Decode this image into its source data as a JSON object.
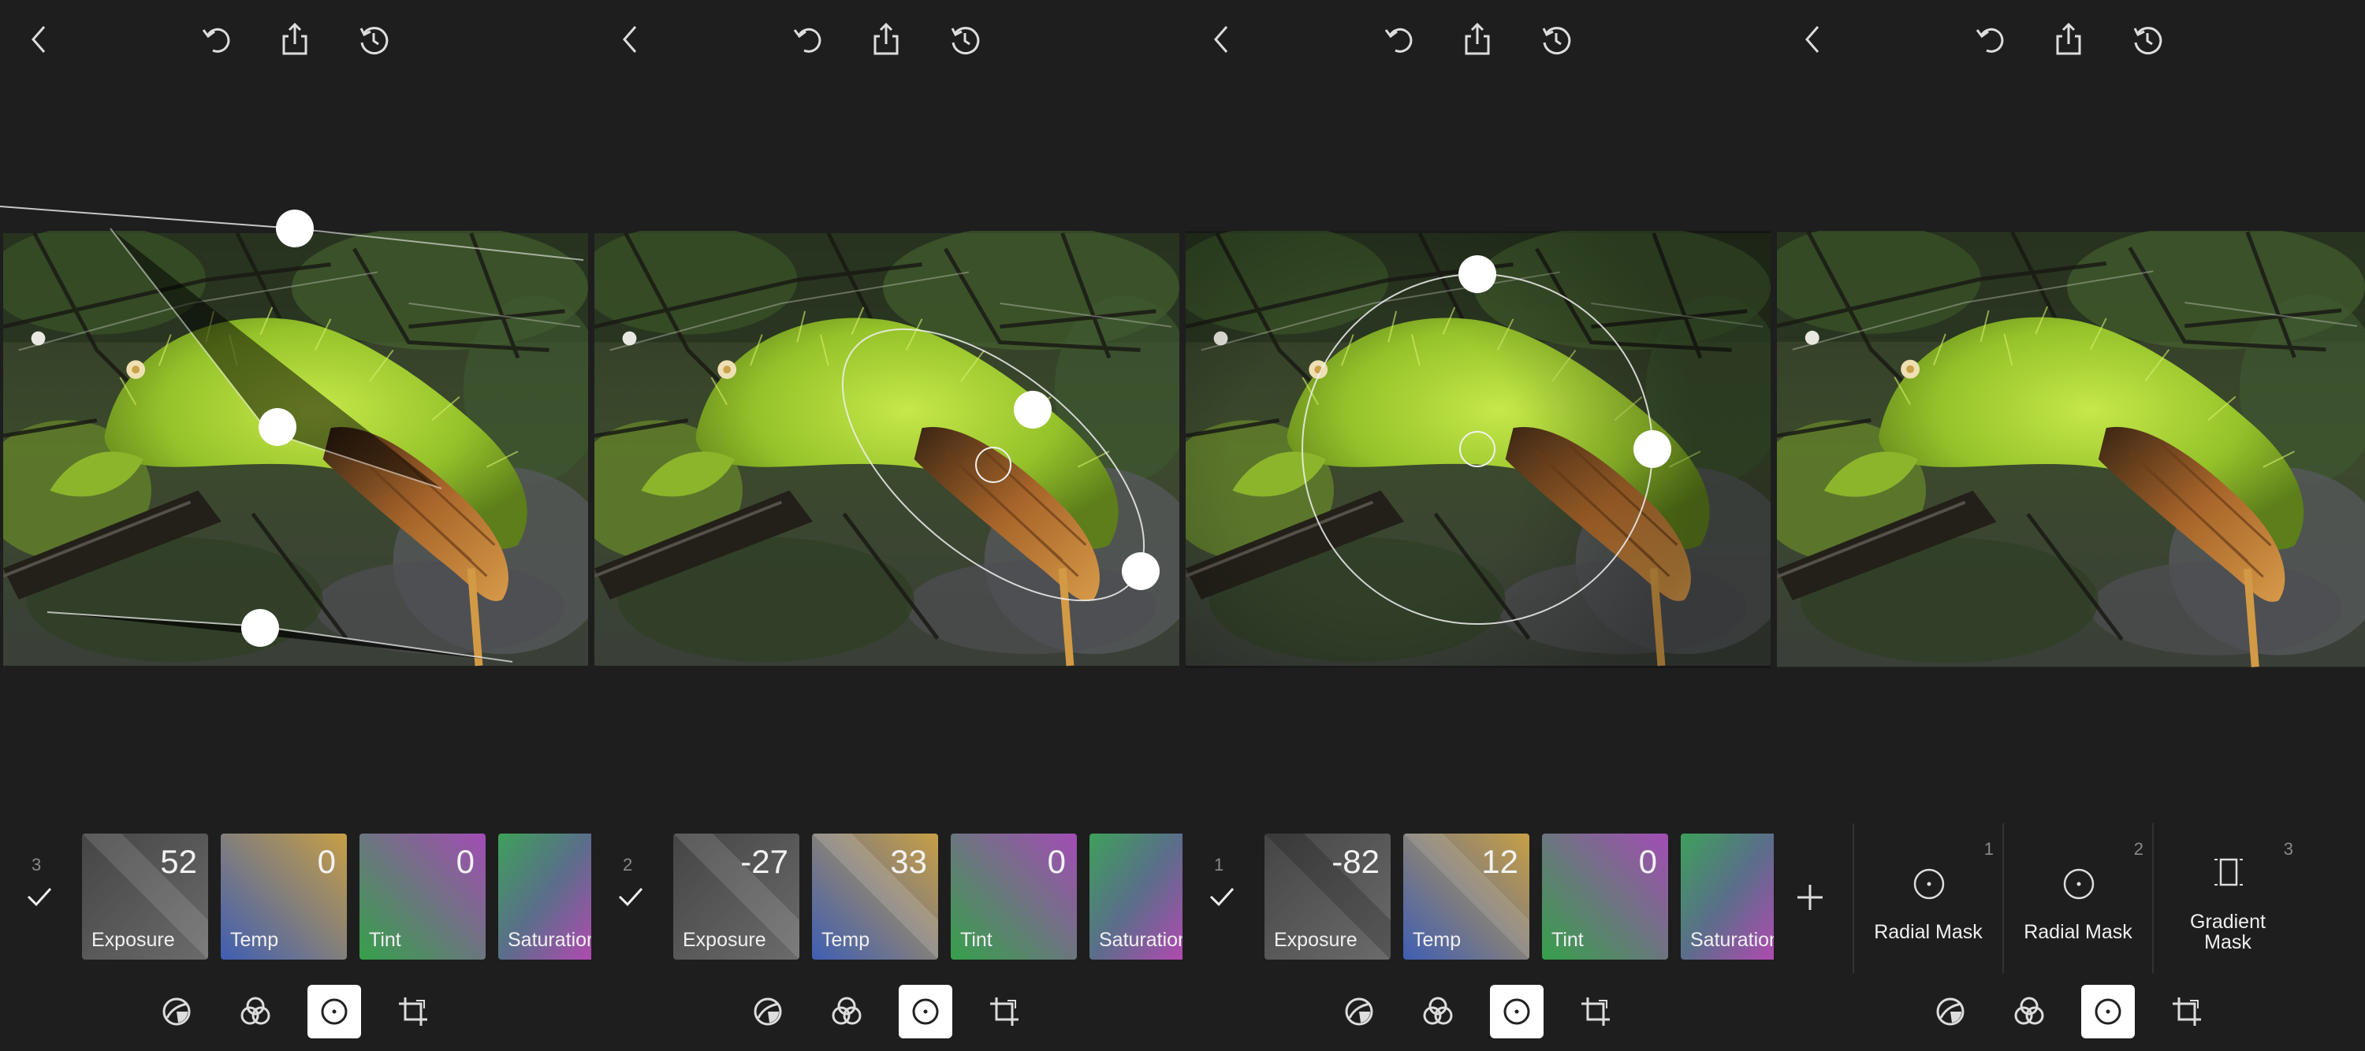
{
  "screens": [
    {
      "layer_count": "3",
      "tiles": [
        {
          "value": "52",
          "label": "Exposure"
        },
        {
          "value": "0",
          "label": "Temp"
        },
        {
          "value": "0",
          "label": "Tint"
        },
        {
          "value": "",
          "label": "Saturation"
        }
      ]
    },
    {
      "layer_count": "2",
      "tiles": [
        {
          "value": "-27",
          "label": "Exposure"
        },
        {
          "value": "33",
          "label": "Temp"
        },
        {
          "value": "0",
          "label": "Tint"
        },
        {
          "value": "",
          "label": "Saturation"
        }
      ]
    },
    {
      "layer_count": "1",
      "tiles": [
        {
          "value": "-82",
          "label": "Exposure"
        },
        {
          "value": "12",
          "label": "Temp"
        },
        {
          "value": "0",
          "label": "Tint"
        },
        {
          "value": "",
          "label": "Saturation"
        }
      ]
    }
  ],
  "mask_panel": {
    "masks": [
      {
        "number": "1",
        "label": "Radial Mask",
        "icon": "radial-mask-icon"
      },
      {
        "number": "2",
        "label": "Radial Mask",
        "icon": "radial-mask-icon"
      },
      {
        "number": "3",
        "label": "Gradient Mask",
        "icon": "gradient-mask-icon"
      }
    ]
  },
  "toolbar_icons": [
    "back-icon",
    "undo-icon",
    "share-icon",
    "revert-icon"
  ],
  "bottom_tools": [
    "tone-curve-icon",
    "color-mix-icon",
    "mask-tool-icon",
    "crop-icon"
  ],
  "colors": {
    "background": "#1e1e1e",
    "active_tool_bg": "#ffffff",
    "exposure_tile": "#5a5a5a",
    "temp_tile_a": "#c9a24a",
    "temp_tile_b": "#4a63b0",
    "tint_tile_a": "#9a4fb0",
    "tint_tile_b": "#3f9a4f"
  }
}
